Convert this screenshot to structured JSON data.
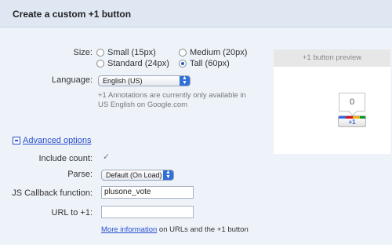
{
  "header": {
    "title": "Create a custom +1 button"
  },
  "size": {
    "label": "Size:",
    "options": [
      {
        "label": "Small (15px)",
        "checked": false
      },
      {
        "label": "Medium (20px)",
        "checked": false
      },
      {
        "label": "Standard (24px)",
        "checked": false
      },
      {
        "label": "Tall (60px)",
        "checked": true
      }
    ]
  },
  "language": {
    "label": "Language:",
    "selected": "English (US)",
    "note_line1": "+1 Annotations are currently only available in",
    "note_line2": "US English on Google.com"
  },
  "advanced": {
    "toggle_label": "Advanced options"
  },
  "include_count": {
    "label": "Include count:",
    "checked": true,
    "check_glyph": "✓"
  },
  "parse": {
    "label": "Parse:",
    "selected": "Default (On Load)"
  },
  "js_callback": {
    "label": "JS Callback function:",
    "value": "plusone_vote"
  },
  "url": {
    "label": "URL to +1:",
    "value": "",
    "info_link": "More information",
    "info_rest": "on URLs and the +1 button"
  },
  "preview": {
    "title": "+1 button preview",
    "count": "0",
    "button_label": "+1"
  },
  "colors": {
    "background": "#eef3fa",
    "header": "#dfe7f3",
    "link": "#2a4fcc",
    "select_arrow": "#2f6fd6"
  },
  "icons": {
    "select_arrows": "up-down-arrows-icon",
    "collapse": "minus-box-icon",
    "checkmark": "checkmark-icon"
  }
}
